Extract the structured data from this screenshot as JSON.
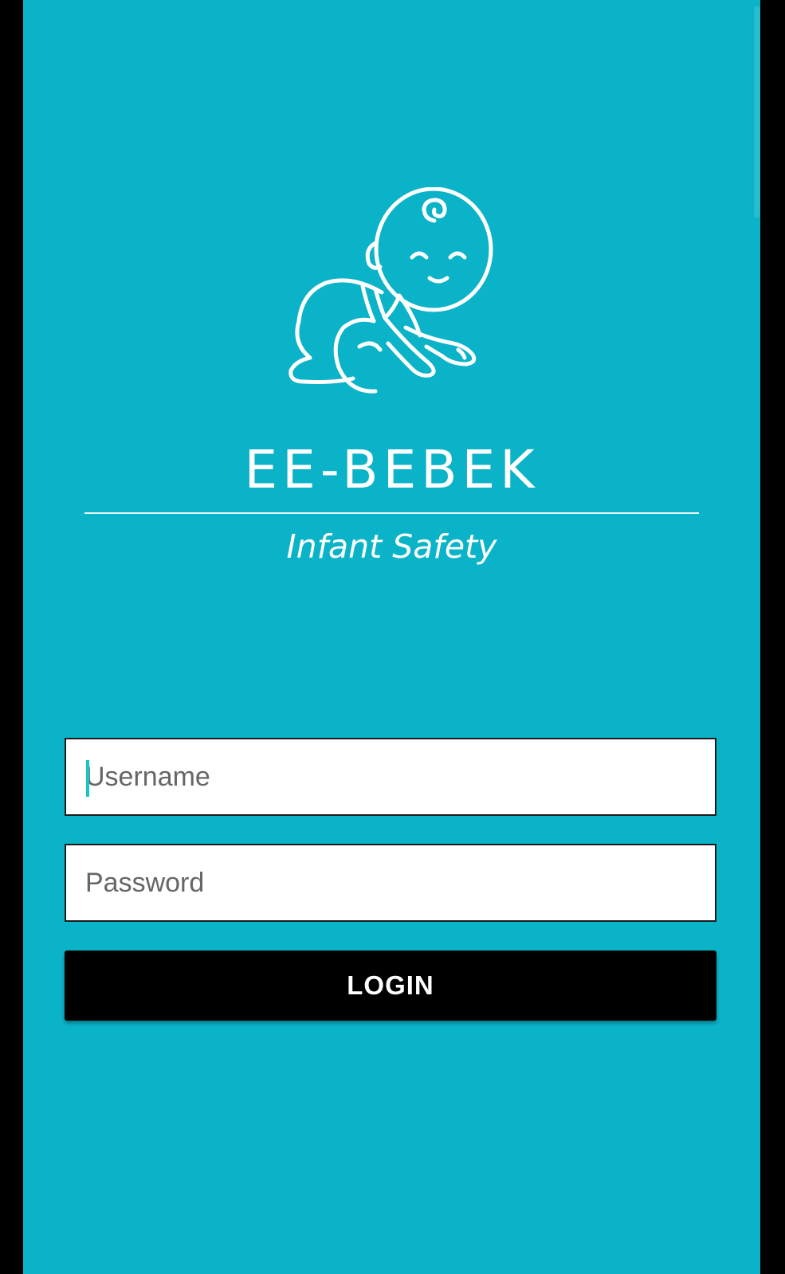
{
  "app": {
    "brand_title": "EE-BEBEK",
    "brand_subtitle": "Infant Safety",
    "logo_icon": "crawling-baby-icon"
  },
  "login_form": {
    "username_placeholder": "Username",
    "username_value": "",
    "password_placeholder": "Password",
    "password_value": "",
    "login_label": "LOGIN"
  },
  "colors": {
    "background": "#0ab3c8",
    "button": "#000000",
    "button_text": "#ffffff",
    "field_background": "#ffffff",
    "cursor": "#17c4c8"
  }
}
